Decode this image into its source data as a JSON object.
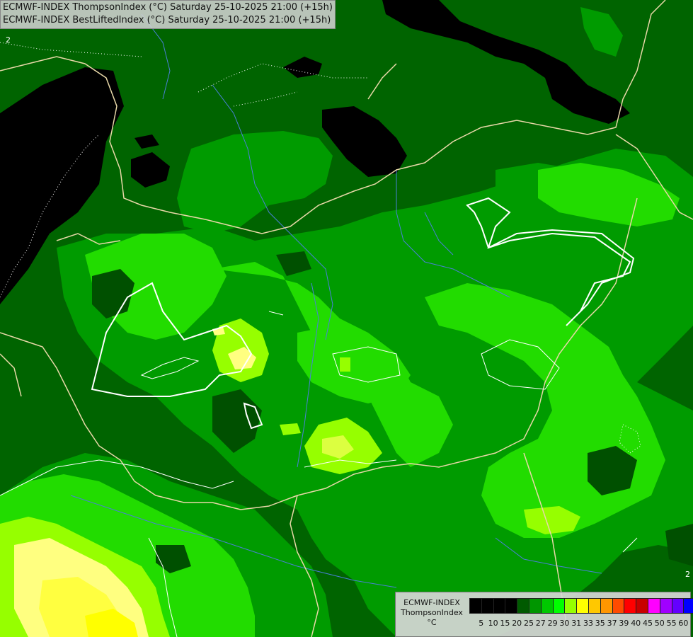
{
  "title": {
    "line1": "ECMWF-INDEX ThompsonIndex (°C) Saturday 25-10-2025 21:00 (+15h)",
    "line2": "ECMWF-INDEX BestLiftedIndex (°C) Saturday 25-10-2025 21:00 (+15h)"
  },
  "contour_labels": [
    "2",
    "2"
  ],
  "legend": {
    "line1": "ECMWF-INDEX",
    "line2": "ThompsonIndex",
    "unit": "°C",
    "ticks": [
      "5",
      "10",
      "15",
      "20",
      "25",
      "27",
      "29",
      "30",
      "31",
      "33",
      "35",
      "37",
      "39",
      "40",
      "45",
      "50",
      "55",
      "60"
    ],
    "colors": [
      "#000000",
      "#000000",
      "#000000",
      "#000000",
      "#005a00",
      "#009600",
      "#00c800",
      "#00ff00",
      "#96ff00",
      "#ffff00",
      "#ffc800",
      "#ff9600",
      "#ff4b00",
      "#ff0000",
      "#c80000",
      "#ff00ff",
      "#a000ff",
      "#6400ff",
      "#0000ff"
    ]
  },
  "colors": {
    "background": "#006400",
    "black_area": "#000000",
    "dark_green": "#005000",
    "medium_green": "#009b00",
    "bright_green": "#22dc00",
    "lime": "#96ff00",
    "yellow_green": "#dcff40",
    "pale_yellow": "#ffff80",
    "yellow": "#ffff00",
    "border_line": "#e8d8a8",
    "river_line": "#4a7fd8",
    "contour_line": "#ffffff"
  }
}
